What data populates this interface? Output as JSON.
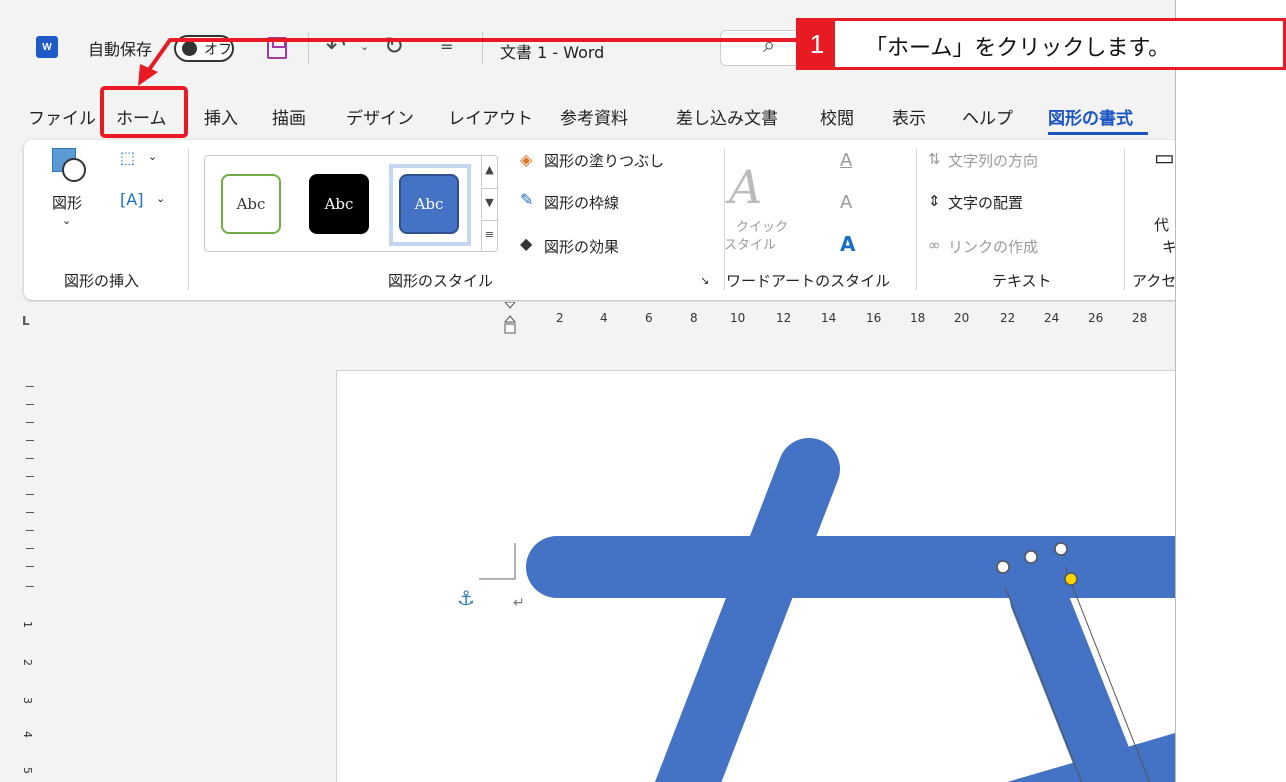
{
  "titlebar": {
    "logo": "W",
    "autosave_label": "自動保存",
    "autosave_state": "オフ",
    "more_caret": "⌄",
    "customize": "=",
    "document_title": "文書 1  -  Word"
  },
  "tabs": [
    {
      "label": "ファイル"
    },
    {
      "label": "ホーム"
    },
    {
      "label": "挿入"
    },
    {
      "label": "描画"
    },
    {
      "label": "デザイン"
    },
    {
      "label": "レイアウト"
    },
    {
      "label": "参考資料"
    },
    {
      "label": "差し込み文書"
    },
    {
      "label": "校閲"
    },
    {
      "label": "表示"
    },
    {
      "label": "ヘルプ"
    },
    {
      "label": "図形の書式"
    }
  ],
  "ribbon": {
    "insert_shapes": {
      "shapes_label": "図形",
      "group_label": "図形の挿入"
    },
    "shape_styles": {
      "swatch_text": "Abc",
      "fill": "図形の塗りつぶし",
      "outline": "図形の枠線",
      "effects": "図形の効果",
      "group_label": "図形のスタイル"
    },
    "wordart": {
      "quick_style_1": "クイック",
      "quick_style_2": "スタイル",
      "group_label": "ワードアートのスタイル"
    },
    "text": {
      "direction": "文字列の方向",
      "align": "文字の配置",
      "link": "リンクの作成",
      "group_label": "テキスト"
    },
    "accessibility": {
      "group_label": "アクセ",
      "alt_text_1": "代",
      "alt_text_2": "キ"
    }
  },
  "ruler": {
    "corner": "L",
    "numbers": [
      "2",
      "4",
      "6",
      "8",
      "10",
      "12",
      "14",
      "16",
      "18",
      "20",
      "22",
      "24",
      "26",
      "28"
    ],
    "vertical_numbers": [
      "1",
      "2",
      "3",
      "4",
      "5"
    ]
  },
  "callout": {
    "step": "1",
    "text": "「ホーム」をクリックします。"
  },
  "colors": {
    "accent_red": "#e81a24",
    "shape_blue": "#4472c4",
    "format_tab_blue": "#1b55c4"
  }
}
